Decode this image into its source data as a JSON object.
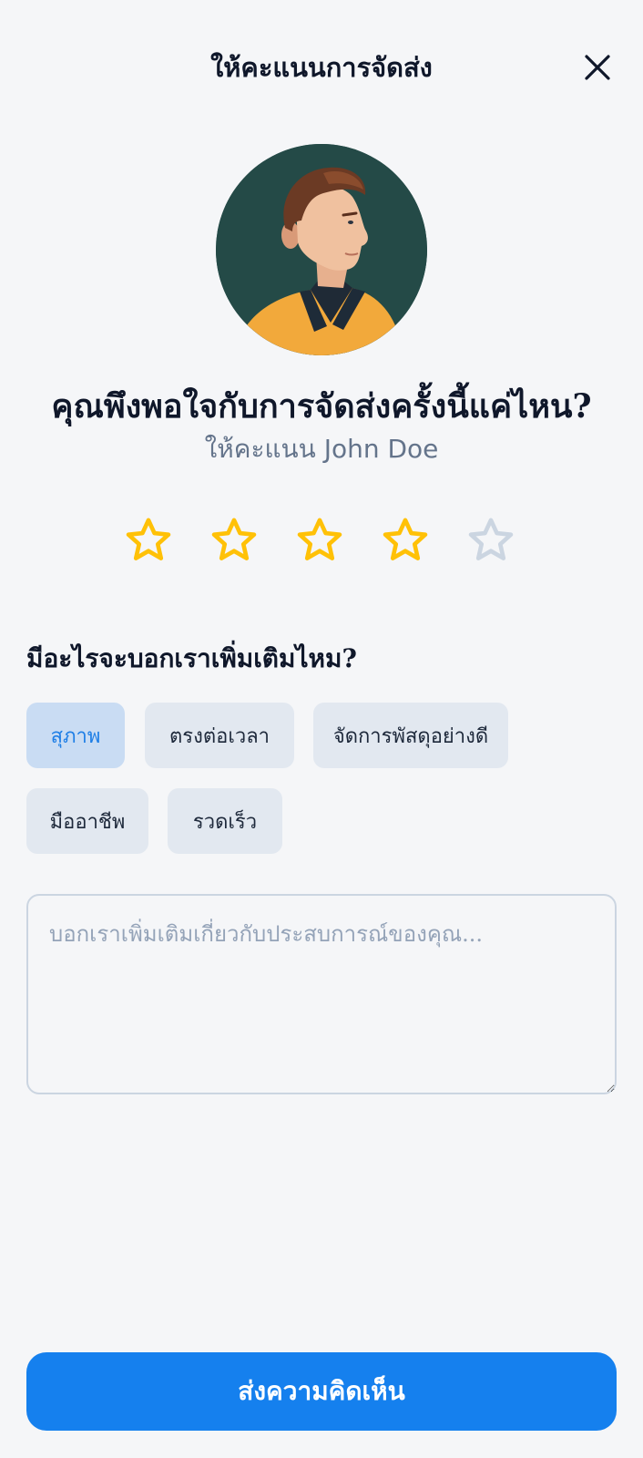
{
  "header": {
    "title": "ให้คะแนนการจัดส่ง",
    "close_icon": "close-icon"
  },
  "driver": {
    "avatar_icon": "driver-avatar",
    "question": "คุณพึงพอใจกับการจัดส่งครั้งนี้แค่ไหน?",
    "rate_label": "ให้คะแนน John Doe"
  },
  "rating": {
    "value": 4,
    "max": 5,
    "filled_color": "#FFC107",
    "empty_color": "#CBD5E1"
  },
  "more": {
    "title": "มีอะไรจะบอกเราเพิ่มเติมไหม?",
    "chips": [
      {
        "label": "สุภาพ",
        "selected": true
      },
      {
        "label": "ตรงต่อเวลา",
        "selected": false
      },
      {
        "label": "จัดการพัสดุอย่างดี",
        "selected": false
      },
      {
        "label": "มืออาชีพ",
        "selected": false
      },
      {
        "label": "รวดเร็ว",
        "selected": false
      }
    ]
  },
  "feedback": {
    "placeholder": "บอกเราเพิ่มเติมเกี่ยวกับประสบการณ์ของคุณ...",
    "value": ""
  },
  "submit": {
    "label": "ส่งความคิดเห็น"
  },
  "colors": {
    "background": "#F5F6F8",
    "accent": "#1580EE",
    "chip_bg": "#E2E8F0",
    "chip_selected_bg": "#C9DCF3",
    "chip_selected_text": "#1F7FE6"
  }
}
